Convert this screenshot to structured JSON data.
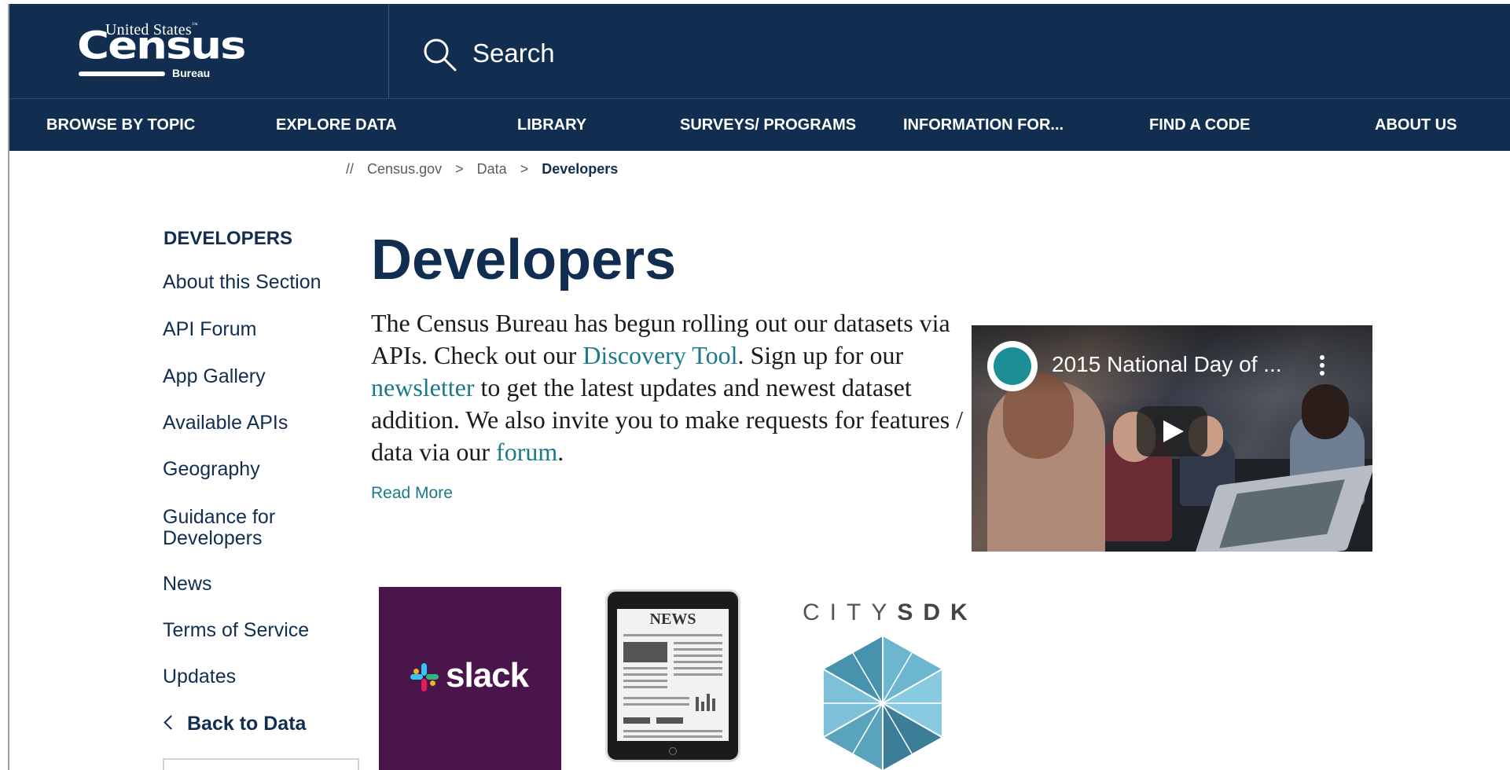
{
  "header": {
    "logo_top": "United States",
    "logo_main": "Census",
    "logo_bureau": "Bureau",
    "search_label": "Search"
  },
  "nav": {
    "items": [
      "BROWSE BY TOPIC",
      "EXPLORE DATA",
      "LIBRARY",
      "SURVEYS/ PROGRAMS",
      "INFORMATION FOR...",
      "FIND A CODE",
      "ABOUT US"
    ]
  },
  "breadcrumb": {
    "prefix": "//",
    "items": [
      "Census.gov",
      "Data",
      "Developers"
    ],
    "separator": ">"
  },
  "sidebar": {
    "heading": "DEVELOPERS",
    "items": [
      "About this Section",
      "API Forum",
      "App Gallery",
      "Available APIs",
      "Geography",
      "Guidance for",
      "Developers",
      "News",
      "Terms of Service",
      "Updates"
    ],
    "back": "Back to Data"
  },
  "main": {
    "title": "Developers",
    "intro": {
      "p1": "The Census Bureau has begun rolling out our datasets via APIs.  Check out our ",
      "link1": "Discovery Tool",
      "p2": ". Sign up for our ",
      "link2": "newsletter",
      "p3": " to get the latest updates and newest dataset addition. We also invite you to make requests for features / data via our ",
      "link3": "forum",
      "p4": "."
    },
    "read_more": "Read More"
  },
  "video": {
    "title": "2015 National Day of ..."
  },
  "tiles": {
    "slack": "slack",
    "news": "NEWS",
    "citysdk_light": "CITY",
    "citysdk_bold": "SDK"
  },
  "colors": {
    "brand_navy": "#112e51",
    "link_teal": "#1b7a8a",
    "slack_purple": "#4a154b"
  }
}
